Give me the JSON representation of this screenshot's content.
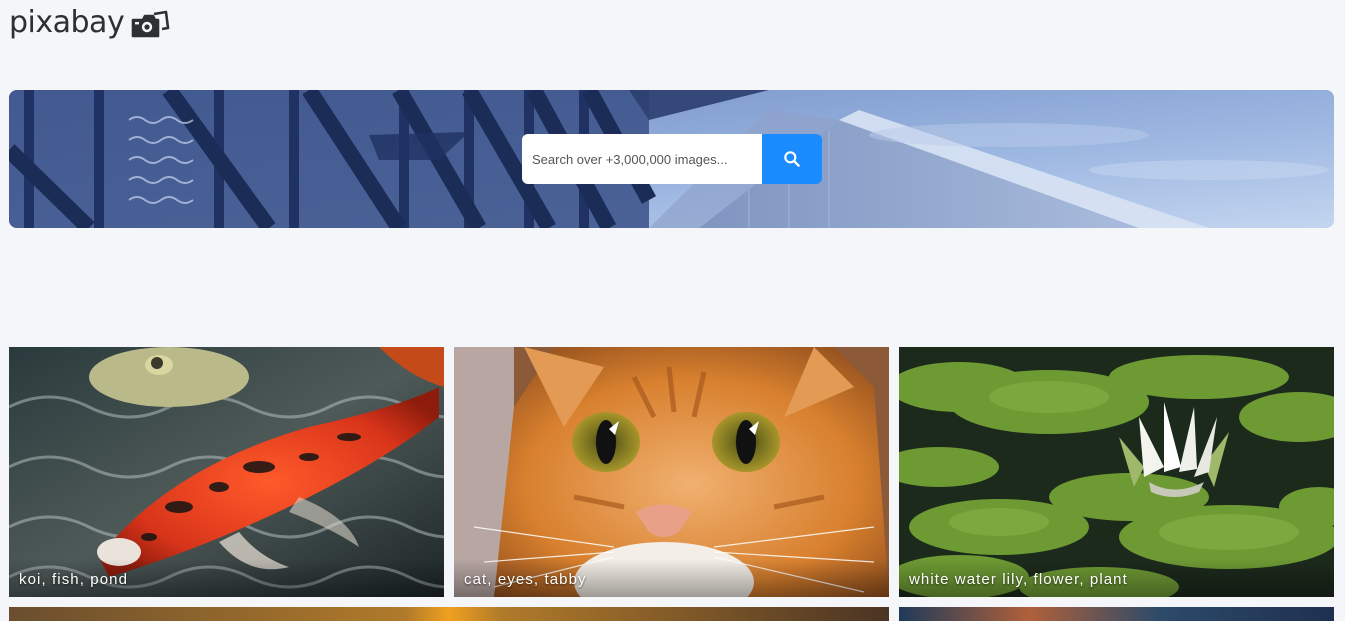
{
  "brand": {
    "name": "pixabay",
    "logo_icon": "camera-icon"
  },
  "search": {
    "placeholder": "Search over +3,000,000 images...",
    "value": "",
    "button_icon": "search-icon",
    "button_color": "#1a8cff"
  },
  "images": [
    {
      "tags": "koi, fish, pond"
    },
    {
      "tags": "cat, eyes, tabby"
    },
    {
      "tags": "white water lily, flower, plant"
    }
  ],
  "colors": {
    "page_background": "#f5f6fa",
    "accent": "#1a8cff"
  }
}
